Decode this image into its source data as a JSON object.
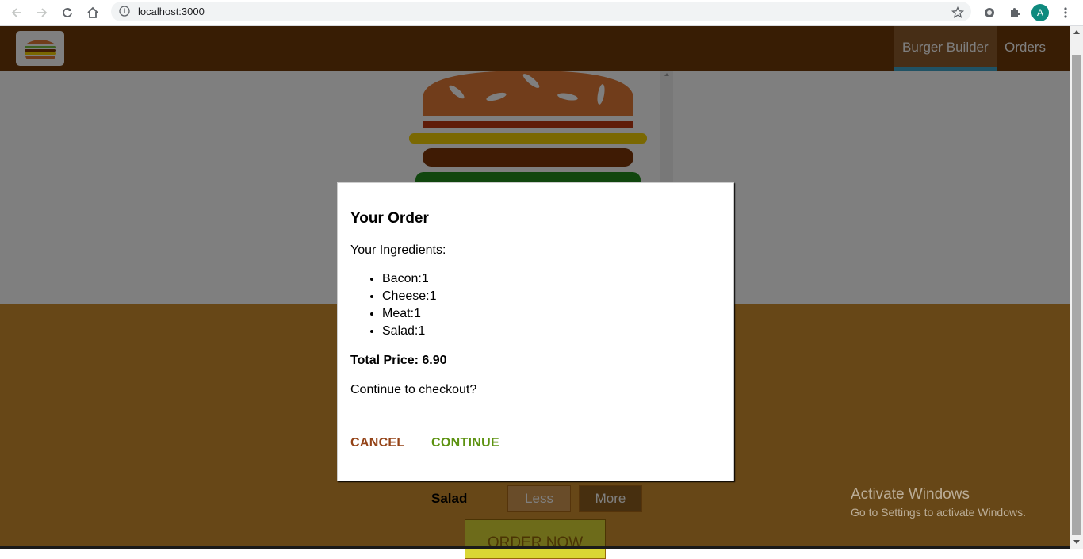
{
  "browser": {
    "url": "localhost:3000",
    "profile_initial": "A",
    "icons": [
      "back-arrow-icon",
      "forward-arrow-icon",
      "reload-icon",
      "home-icon",
      "info-icon",
      "star-icon",
      "extension-icon",
      "puzzle-icon",
      "kebab-menu-icon"
    ]
  },
  "toolbar": {
    "nav": [
      {
        "label": "Burger Builder",
        "active": true
      },
      {
        "label": "Orders",
        "active": false
      }
    ]
  },
  "controls": {
    "label": "Salad",
    "less_label": "Less",
    "more_label": "More",
    "order_label": "ORDER NOW"
  },
  "modal": {
    "title": "Your Order",
    "intro": "Your Ingredients:",
    "ingredients": [
      "Bacon:1",
      "Cheese:1",
      "Meat:1",
      "Salad:1"
    ],
    "total": "Total Price: 6.90",
    "question": "Continue to checkout?",
    "cancel_label": "CANCEL",
    "continue_label": "CONTINUE"
  },
  "watermark": {
    "title": "Activate Windows",
    "subtitle": "Go to Settings to activate Windows."
  },
  "colors": {
    "toolbar": "#703b09",
    "build_controls": "#cf8f2e",
    "cancel": "#944317",
    "continue": "#5c9210",
    "active_nav_border": "#40a4c8"
  }
}
